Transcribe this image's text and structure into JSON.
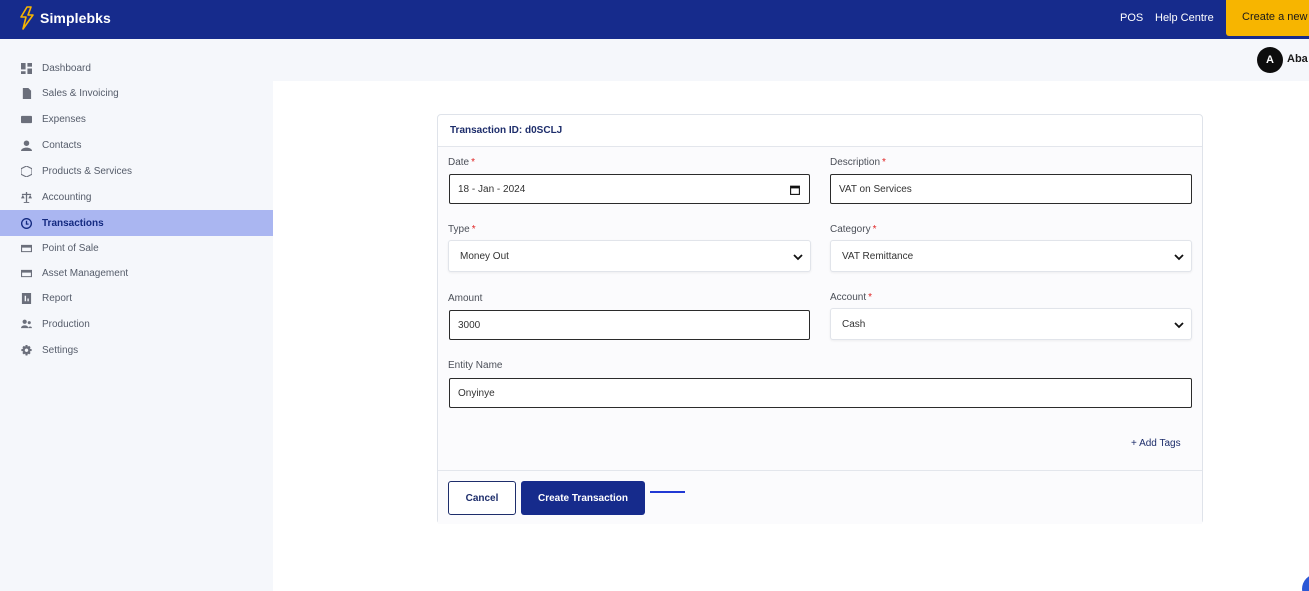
{
  "app": {
    "brand": "Simplebks"
  },
  "topnav": {
    "pos": "POS",
    "help": "Help Centre",
    "create_new": "Create a new"
  },
  "user": {
    "initial": "A",
    "name": "Aba"
  },
  "sidebar": {
    "items": [
      {
        "label": "Dashboard",
        "icon": "dashboard-icon"
      },
      {
        "label": "Sales & Invoicing",
        "icon": "document-icon"
      },
      {
        "label": "Expenses",
        "icon": "wallet-icon"
      },
      {
        "label": "Contacts",
        "icon": "person-icon"
      },
      {
        "label": "Products & Services",
        "icon": "box-icon"
      },
      {
        "label": "Accounting",
        "icon": "scale-icon"
      },
      {
        "label": "Transactions",
        "icon": "transactions-icon",
        "active": true
      },
      {
        "label": "Point of Sale",
        "icon": "card-icon"
      },
      {
        "label": "Asset Management",
        "icon": "card-icon"
      },
      {
        "label": "Report",
        "icon": "report-icon"
      },
      {
        "label": "Production",
        "icon": "people-icon"
      },
      {
        "label": "Settings",
        "icon": "gear-icon"
      }
    ]
  },
  "form": {
    "transaction_id": "Transaction ID: d0SCLJ",
    "date": {
      "label": "Date",
      "value": "18 - Jan - 2024"
    },
    "description": {
      "label": "Description",
      "value": "VAT on Services"
    },
    "type": {
      "label": "Type",
      "value": "Money Out"
    },
    "category": {
      "label": "Category",
      "value": "VAT Remittance"
    },
    "amount": {
      "label": "Amount",
      "value": "3000"
    },
    "account": {
      "label": "Account",
      "value": "Cash"
    },
    "entity": {
      "label": "Entity Name",
      "value": "Onyinye"
    },
    "required_mark": "*",
    "add_tags": "+ Add Tags",
    "cancel": "Cancel",
    "create": "Create Transaction"
  },
  "colors": {
    "primary": "#162b8c",
    "accent": "#f7b500",
    "active_nav": "#aab6f1",
    "required": "#e02424"
  }
}
